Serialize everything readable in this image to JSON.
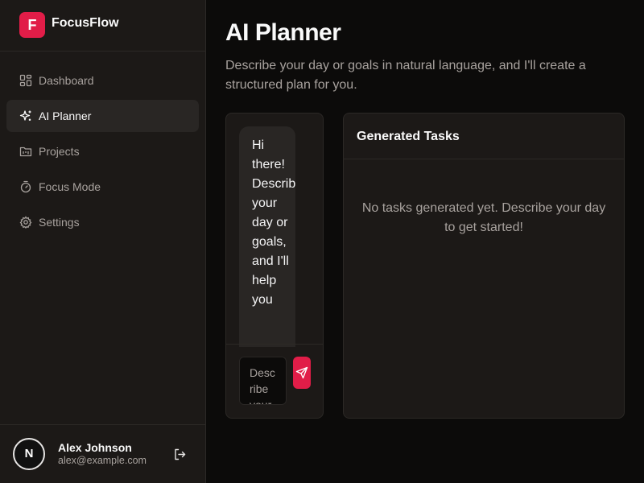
{
  "brand": {
    "logo_letter": "F",
    "name": "FocusFlow",
    "accent": "#e11d48"
  },
  "sidebar": {
    "items": [
      {
        "label": "Dashboard",
        "icon": "dashboard-icon",
        "active": false
      },
      {
        "label": "AI Planner",
        "icon": "sparkles-icon",
        "active": true
      },
      {
        "label": "Projects",
        "icon": "folder-icon",
        "active": false
      },
      {
        "label": "Focus Mode",
        "icon": "timer-icon",
        "active": false
      },
      {
        "label": "Settings",
        "icon": "gear-icon",
        "active": false
      }
    ]
  },
  "user": {
    "avatar_letter": "N",
    "name": "Alex Johnson",
    "email": "alex@example.com"
  },
  "main": {
    "title": "AI Planner",
    "subtitle": "Describe your day or goals in natural language, and I'll create a structured plan for you."
  },
  "chat": {
    "message": "Hi there! Describe your day or goals, and I'll help you",
    "input_placeholder": "Describe your day..."
  },
  "tasks": {
    "title": "Generated Tasks",
    "empty_text": "No tasks generated yet. Describe your day to get started!"
  }
}
